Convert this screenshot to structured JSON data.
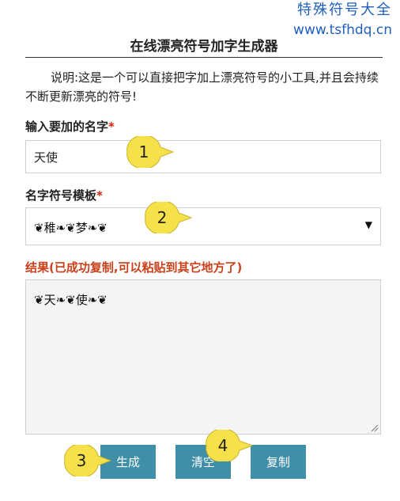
{
  "watermark": {
    "site_name": "特殊符号大全",
    "site_url": "www.tsfhdq.cn"
  },
  "page": {
    "title": "在线漂亮符号加字生成器",
    "description": "说明:这是一个可以直接把字加上漂亮符号的小工具,并且会持续不断更新漂亮的符号!"
  },
  "form": {
    "name_label": "输入要加的名字",
    "required_mark": "*",
    "name_value": "天使",
    "template_label": "名字符号模板",
    "template_value": "❦稚❧❦梦❧❦",
    "result_label": "结果(已成功复制,可以粘贴到其它地方了)",
    "result_value": "❦天❧❦使❧❦"
  },
  "buttons": {
    "generate": "生成",
    "clear": "清空",
    "copy": "复制"
  },
  "callouts": [
    "1",
    "2",
    "3",
    "4"
  ],
  "colors": {
    "button_bg": "#3f8fa8",
    "callout_fill": "#f7e14b",
    "required": "#d81e06",
    "result_label": "#c9401a",
    "watermark": "#1f5fbf"
  },
  "icons": {
    "select_arrow": "triangle-down-icon",
    "resize": "resize-grip-icon"
  }
}
